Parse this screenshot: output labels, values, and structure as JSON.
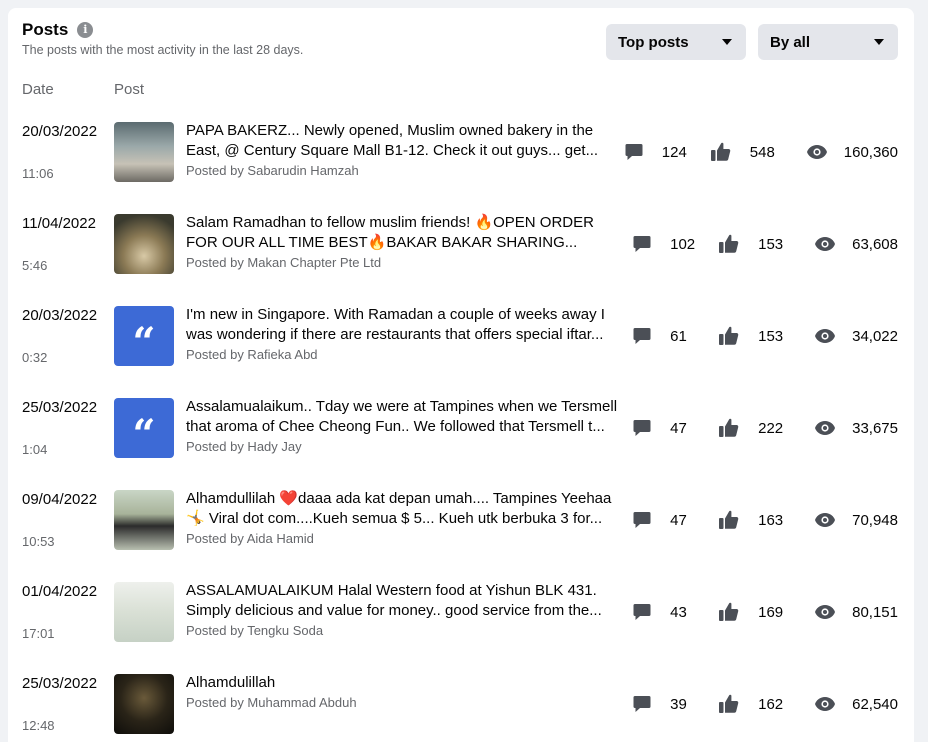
{
  "header": {
    "title": "Posts",
    "subtitle": "The posts with the most activity in the last 28 days.",
    "info_icon": "i",
    "sort_dropdown": "Top posts",
    "filter_dropdown": "By all"
  },
  "columns": {
    "date": "Date",
    "post": "Post"
  },
  "posts": [
    {
      "date": "20/03/2022",
      "time": "11:06",
      "thumb": "photo1",
      "text": "PAPA BAKERZ... Newly opened, Muslim owned bakery in the East, @ Century Square Mall B1-12. Check it out guys... get...",
      "author": "Posted by Sabarudin Hamzah",
      "comments": "124",
      "likes": "548",
      "views": "160,360"
    },
    {
      "date": "11/04/2022",
      "time": "5:46",
      "thumb": "photo2",
      "text": "Salam Ramadhan to fellow muslim friends! 🔥OPEN ORDER FOR OUR ALL TIME BEST🔥BAKAR BAKAR SHARING...",
      "author": "Posted by Makan Chapter Pte Ltd",
      "comments": "102",
      "likes": "153",
      "views": "63,608"
    },
    {
      "date": "20/03/2022",
      "time": "0:32",
      "thumb": "quote",
      "text": "I'm new in Singapore. With Ramadan a couple of weeks away I was wondering if there are restaurants that offers special iftar...",
      "author": "Posted by Rafieka Abd",
      "comments": "61",
      "likes": "153",
      "views": "34,022"
    },
    {
      "date": "25/03/2022",
      "time": "1:04",
      "thumb": "quote",
      "text": "Assalamualaikum.. Tday we were at Tampines when we Tersmell that aroma of Chee Cheong Fun.. We followed that Tersmell t...",
      "author": "Posted by Hady Jay",
      "comments": "47",
      "likes": "222",
      "views": "33,675"
    },
    {
      "date": "09/04/2022",
      "time": "10:53",
      "thumb": "photo3",
      "text": "Alhamdullilah ❤️daaa ada kat depan umah.... Tampines Yeehaa 🤸 Viral dot com....Kueh semua $ 5... Kueh utk berbuka 3 for...",
      "author": "Posted by Aida Hamid",
      "comments": "47",
      "likes": "163",
      "views": "70,948"
    },
    {
      "date": "01/04/2022",
      "time": "17:01",
      "thumb": "photo4",
      "text": "ASSALAMUALAIKUM Halal Western food at Yishun BLK 431. Simply delicious and value for money.. good service from the...",
      "author": "Posted by Tengku Soda",
      "comments": "43",
      "likes": "169",
      "views": "80,151"
    },
    {
      "date": "25/03/2022",
      "time": "12:48",
      "thumb": "photo5",
      "text": "Alhamdulillah",
      "author": "Posted by Muhammad Abduh",
      "comments": "39",
      "likes": "162",
      "views": "62,540"
    }
  ],
  "quote_glyph": "“",
  "icons": {
    "comment": "comment-icon",
    "like": "thumbs-up-icon",
    "view": "eye-icon",
    "info": "info-icon",
    "caret": "caret-down-icon"
  }
}
